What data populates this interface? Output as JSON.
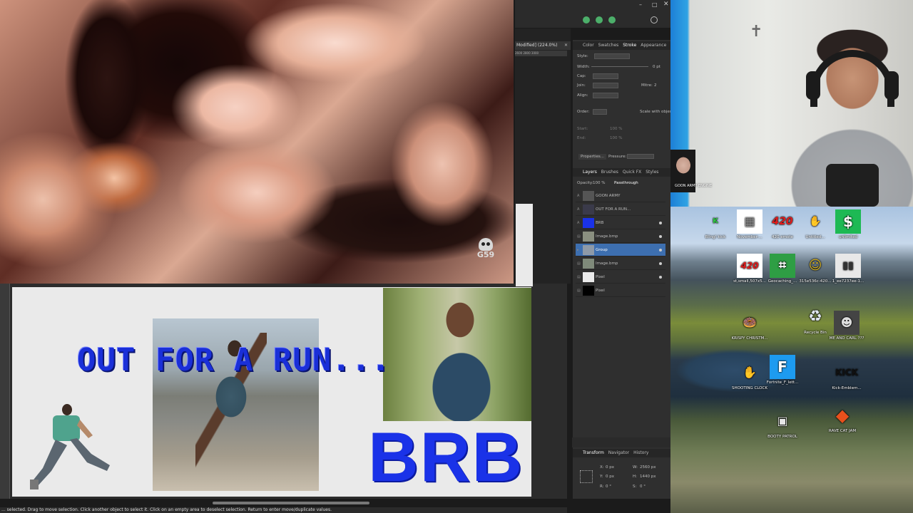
{
  "video": {
    "watermark": "G59"
  },
  "canvas": {
    "headline": "OUT FOR A RUN...",
    "brb": "BRB",
    "status": "... selected. Drag to move selection. Click another object to select it. Click on an empty area to deselect selection. Return to enter move/duplicate values."
  },
  "doc_tab": {
    "title": "Modified] (224.0%)",
    "ruler": "2600   2800   3000"
  },
  "panel": {
    "stroke_tabs": [
      "Color",
      "Swatches",
      "Stroke",
      "Appearance"
    ],
    "style_label": "Style:",
    "width_label": "Width:",
    "width_value": "0 pt",
    "cap_label": "Cap:",
    "join_label": "Join:",
    "mitre_label": "Mitre:",
    "mitre_value": "2",
    "align_label": "Align:",
    "order_label": "Order:",
    "scale_label": "Scale with object",
    "start_label": "Start:",
    "start_pct": "100 %",
    "end_label": "End:",
    "end_pct": "100 %",
    "properties_label": "Properties...",
    "pressure_label": "Pressure:",
    "layer_tabs": [
      "Layers",
      "Brushes",
      "Quick FX",
      "Styles"
    ],
    "opacity_label": "Opacity:",
    "opacity_value": "100 %",
    "blend_mode": "Passthrough",
    "layers": [
      {
        "name": "GOON ARMY",
        "selected": false
      },
      {
        "name": "OUT FOR A RUN...",
        "selected": false
      },
      {
        "name": "BRB",
        "selected": false
      },
      {
        "name": "Image.bmp",
        "selected": false
      },
      {
        "name": "Group",
        "selected": true
      },
      {
        "name": "Image.bmp",
        "selected": false
      },
      {
        "name": "Pixel",
        "selected": false
      },
      {
        "name": "Pixel",
        "selected": false
      }
    ],
    "transform_tabs": [
      "Transform",
      "Navigator",
      "History"
    ],
    "x_label": "X:",
    "x_value": "0 px",
    "y_label": "Y:",
    "y_value": "0 px",
    "w_label": "W:",
    "w_value": "2560 px",
    "h_label": "H:",
    "h_value": "1440 px",
    "r_label": "R:",
    "r_value": "0 °",
    "s_label": "S:",
    "s_value": "0 °"
  },
  "webcam": {
    "overlay_text": "GOON ARMY ENGINE"
  },
  "desktop_icons": [
    {
      "label": "Bling! kick",
      "glyph": "K",
      "color": "#2ecc40"
    },
    {
      "label": "November-...",
      "glyph": "▦",
      "color": "#ffffff"
    },
    {
      "label": "420 emote",
      "glyph": "420",
      "color": "#e21b1b"
    },
    {
      "label": "Untitled...",
      "glyph": "✋",
      "color": "#cccccc"
    },
    {
      "label": "unlimited",
      "glyph": "$",
      "color": "#1db954"
    },
    {
      "label": "st,small,507x5...",
      "glyph": "420",
      "color": "#e21b1b"
    },
    {
      "label": "Geocaching_...",
      "glyph": "⌗",
      "color": "#2e9e44"
    },
    {
      "label": "315e536c-420...",
      "glyph": "☺",
      "color": "#d4b020"
    },
    {
      "label": "1_ee7237ee-1...",
      "glyph": "▮▮",
      "color": "#333333"
    },
    {
      "label": "KRISPY CHRISTM...",
      "glyph": "🍩",
      "color": "#8b5a3c"
    },
    {
      "label": "Recycle Bin",
      "glyph": "♻",
      "color": "#dfe6ee"
    },
    {
      "label": "ME AND CARL ???",
      "glyph": "☻",
      "color": "#444444"
    },
    {
      "label": "SHOOTING CLOCK",
      "glyph": "✋",
      "color": "#d9d9d9"
    },
    {
      "label": "Fortnite_F_lett...",
      "glyph": "F",
      "color": "#1d9bf0"
    },
    {
      "label": "Kick-Emblem...",
      "glyph": "KICK",
      "color": "#111111"
    },
    {
      "label": "BOOTY PATROL",
      "glyph": "▣",
      "color": "#e6e6e6"
    },
    {
      "label": "RAVE CAT JAM",
      "glyph": "◆",
      "color": "#e8501c"
    }
  ]
}
